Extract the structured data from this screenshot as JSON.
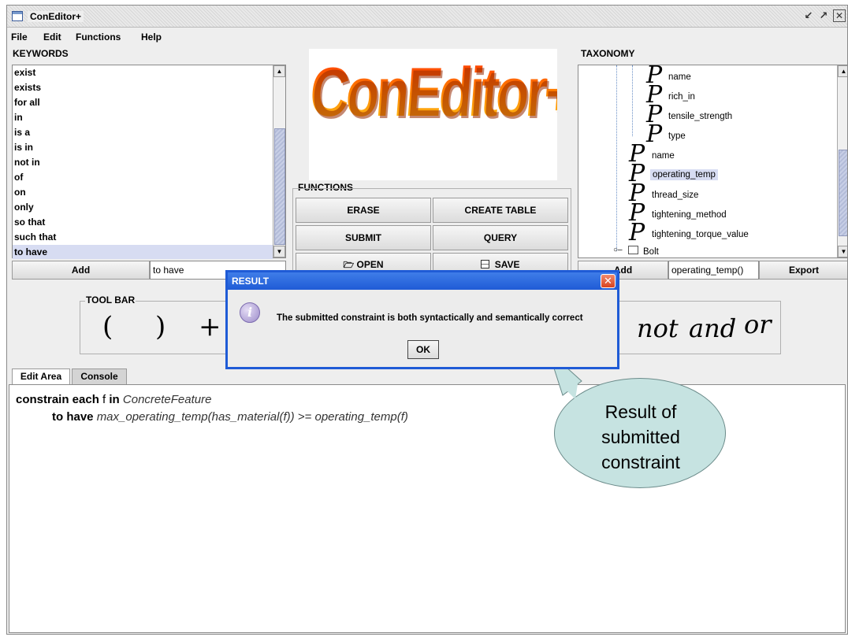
{
  "window": {
    "title": "ConEditor+",
    "controls": [
      "restore-icon",
      "maximize-icon",
      "close-icon"
    ]
  },
  "menu": [
    "File",
    "Edit",
    "Functions",
    "Help"
  ],
  "keywords": {
    "label": "KEYWORDS",
    "items": [
      "exist",
      "exists",
      "for all",
      "in",
      "is a",
      "is in",
      "not in",
      "of",
      "on",
      "only",
      "so that",
      "such that",
      "to have"
    ],
    "selected": "to have",
    "add_label": "Add",
    "input_value": "to have"
  },
  "logo": {
    "text": "ConEditor+"
  },
  "functions": {
    "label": "FUNCTIONS",
    "buttons": [
      "ERASE",
      "CREATE TABLE",
      "SUBMIT",
      "QUERY",
      "OPEN",
      "SAVE"
    ]
  },
  "taxonomy": {
    "label": "TAXONOMY",
    "glyph": "P",
    "nested_properties": [
      "name",
      "rich_in",
      "tensile_strength",
      "type"
    ],
    "properties": [
      "name",
      "operating_temp",
      "thread_size",
      "tightening_method",
      "tightening_torque_value"
    ],
    "selected": "operating_temp",
    "folder": "Bolt",
    "add_label": "Add",
    "input_value": "operating_temp()",
    "export_label": "Export"
  },
  "toolbar": {
    "label": "TOOL BAR",
    "symbols": [
      "(",
      ")",
      "+"
    ],
    "words": [
      "not",
      "and",
      "or"
    ]
  },
  "tabs": [
    "Edit Area",
    "Console"
  ],
  "active_tab": "Edit Area",
  "editor": {
    "line1_kw1": "constrain each",
    "line1_var": "f",
    "line1_kw2": "in",
    "line1_concept": "ConcreteFeature",
    "line2_kw": "to have",
    "line2_expr": "max_operating_temp(has_material(f)) >= operating_temp(f)"
  },
  "dialog": {
    "title": "RESULT",
    "message": "The submitted constraint is both syntactically and semantically correct",
    "ok_label": "OK"
  },
  "callout": {
    "lines": [
      "Result of",
      "submitted",
      "constraint"
    ]
  },
  "colors": {
    "selection": "#d7dcf2",
    "dialog_border": "#1f5bd6",
    "callout_fill": "#c6e3e1",
    "logo_top": "#ff2a00",
    "logo_bottom": "#ffd21c"
  }
}
